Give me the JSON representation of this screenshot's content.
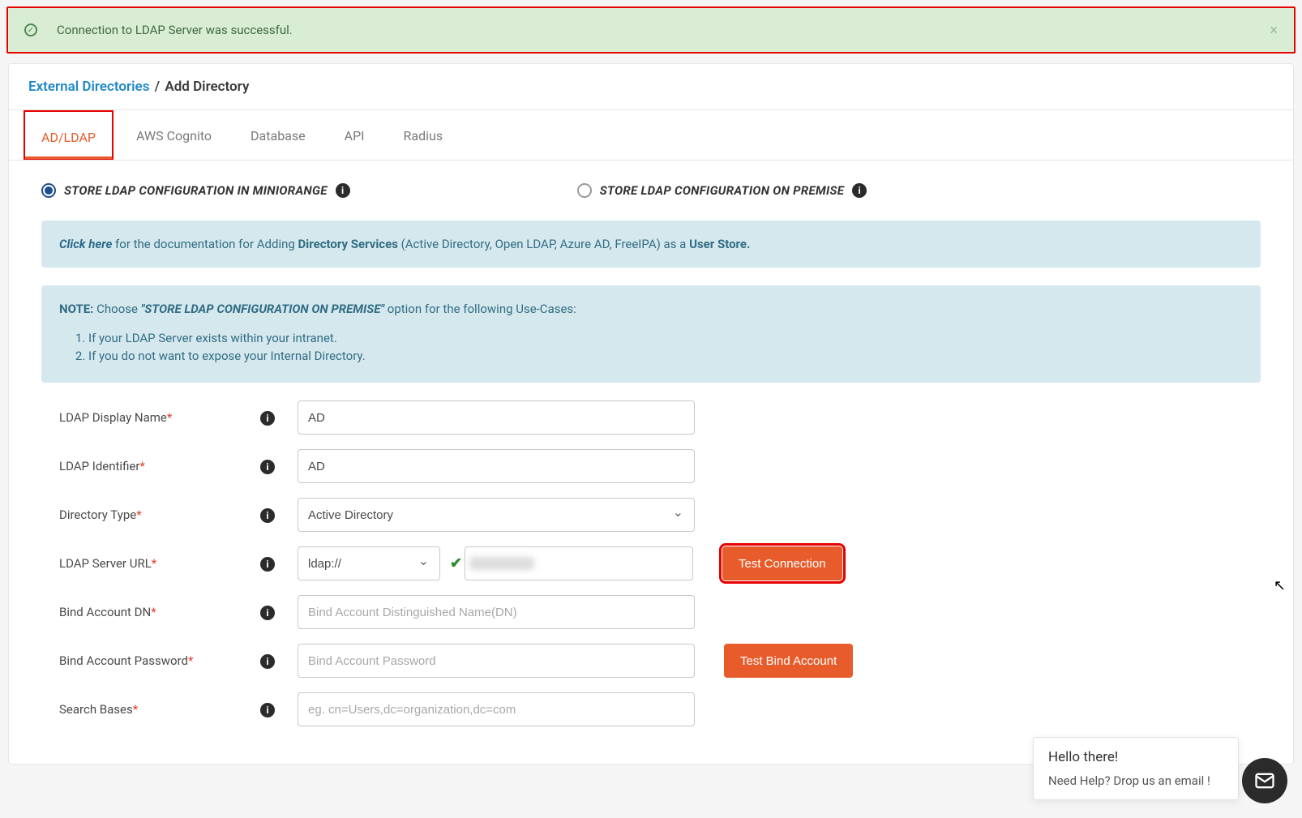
{
  "alert": {
    "message": "Connection to LDAP Server was successful."
  },
  "breadcrumb": {
    "link": "External Directories",
    "current": "Add Directory"
  },
  "tabs": [
    {
      "label": "AD/LDAP",
      "active": true
    },
    {
      "label": "AWS Cognito",
      "active": false
    },
    {
      "label": "Database",
      "active": false
    },
    {
      "label": "API",
      "active": false
    },
    {
      "label": "Radius",
      "active": false
    }
  ],
  "radios": {
    "miniorange": "STORE LDAP CONFIGURATION IN MINIORANGE",
    "onpremise": "STORE LDAP CONFIGURATION ON PREMISE"
  },
  "doc_banner": {
    "click_here": "Click here",
    "mid1": " for the documentation for Adding ",
    "dir_services": "Directory Services",
    "mid2": " (Active Directory, Open LDAP, Azure AD, FreeIPA) as a ",
    "user_store": "User Store."
  },
  "note_banner": {
    "note_label": "NOTE:",
    "choose_text": "  Choose  ",
    "quoted": "\"STORE LDAP CONFIGURATION ON PREMISE\"",
    "after": " option for the following Use-Cases:",
    "item1": "If your LDAP Server exists within your intranet.",
    "item2": "If you do not want to expose your Internal Directory."
  },
  "form": {
    "display_name": {
      "label": "LDAP Display Name",
      "value": "AD"
    },
    "identifier": {
      "label": "LDAP Identifier",
      "value": "AD"
    },
    "dir_type": {
      "label": "Directory Type",
      "value": "Active Directory"
    },
    "server_url": {
      "label": "LDAP Server URL",
      "protocol": "ldap://"
    },
    "bind_dn": {
      "label": "Bind Account DN",
      "placeholder": "Bind Account Distinguished Name(DN)"
    },
    "bind_pw": {
      "label": "Bind Account Password",
      "placeholder": "Bind Account Password"
    },
    "search_base": {
      "label": "Search Bases",
      "placeholder": "eg. cn=Users,dc=organization,dc=com"
    }
  },
  "buttons": {
    "test_connection": "Test Connection",
    "test_bind": "Test Bind Account"
  },
  "chat": {
    "line1": "Hello there!",
    "line2": "Need Help? Drop us an email !"
  }
}
